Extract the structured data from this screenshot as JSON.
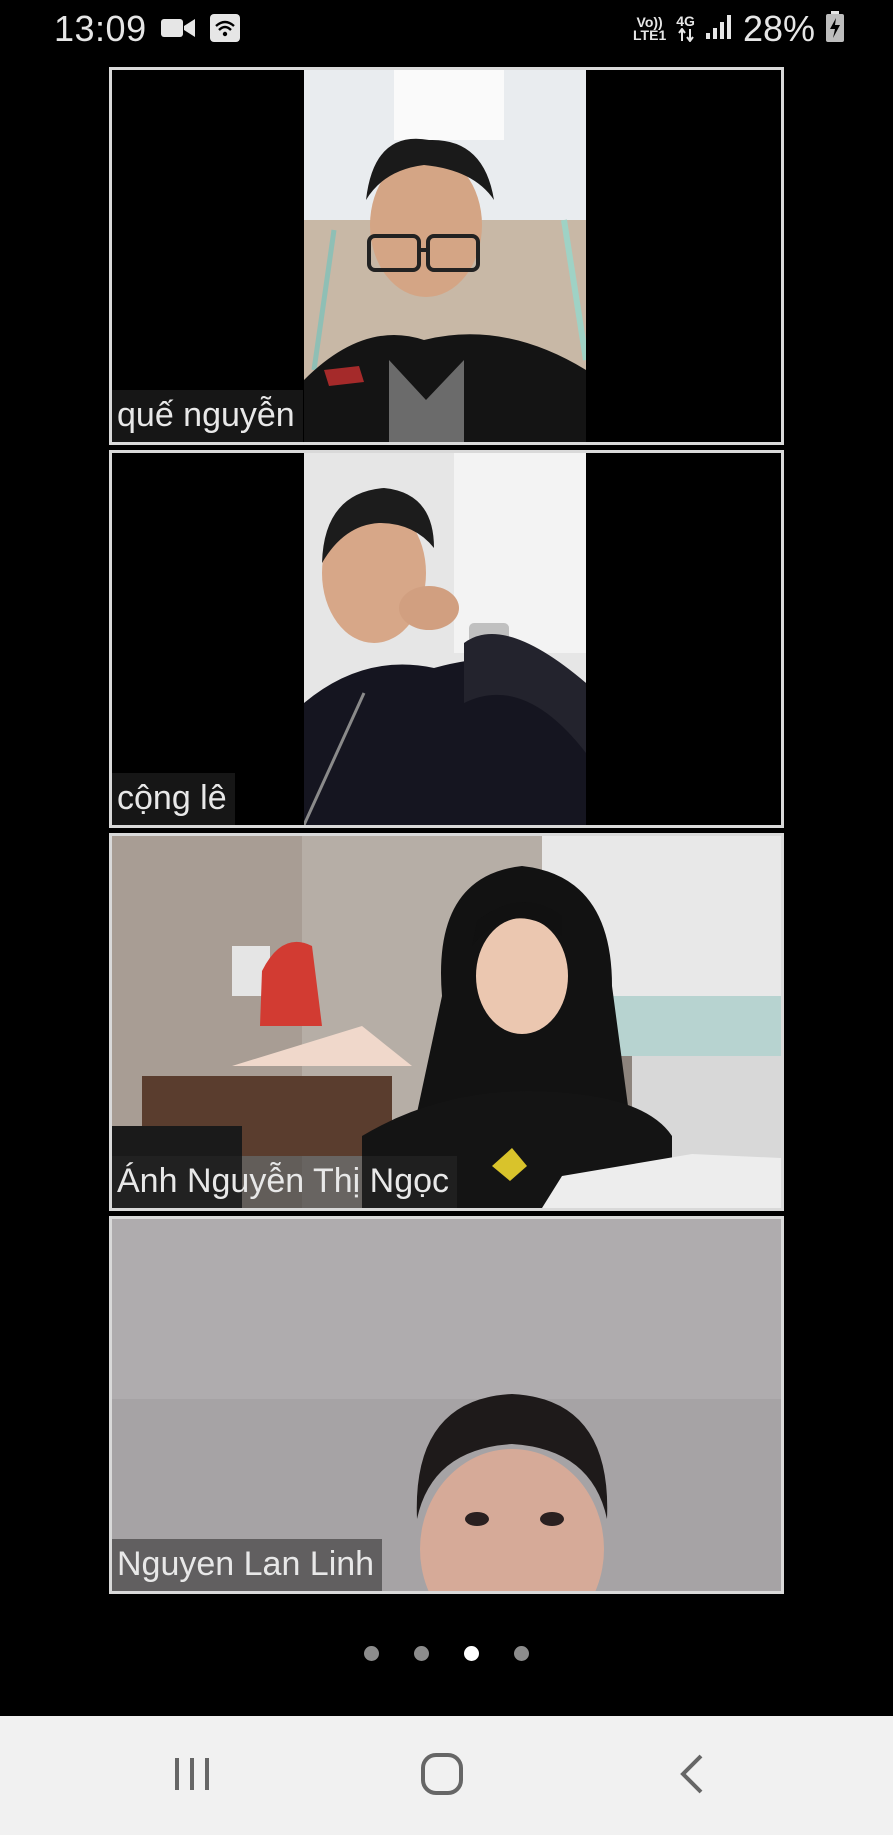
{
  "status_bar": {
    "time": "13:09",
    "network_top": "Vo))",
    "network_bottom": "LTE1",
    "network_type": "4G",
    "battery_percent": "28%",
    "icons": [
      "video-call-icon",
      "wifi-icon",
      "signal-icon",
      "battery-charging-icon"
    ]
  },
  "participants": [
    {
      "name": "quế nguyễn"
    },
    {
      "name": "cộng lê"
    },
    {
      "name": "Ánh Nguyễn Thị Ngọc"
    },
    {
      "name": "Nguyen Lan Linh"
    }
  ],
  "pager": {
    "total_pages": 4,
    "active_page": 3
  },
  "navigation": {
    "icons": [
      "recent-apps-icon",
      "home-icon",
      "back-icon"
    ]
  }
}
